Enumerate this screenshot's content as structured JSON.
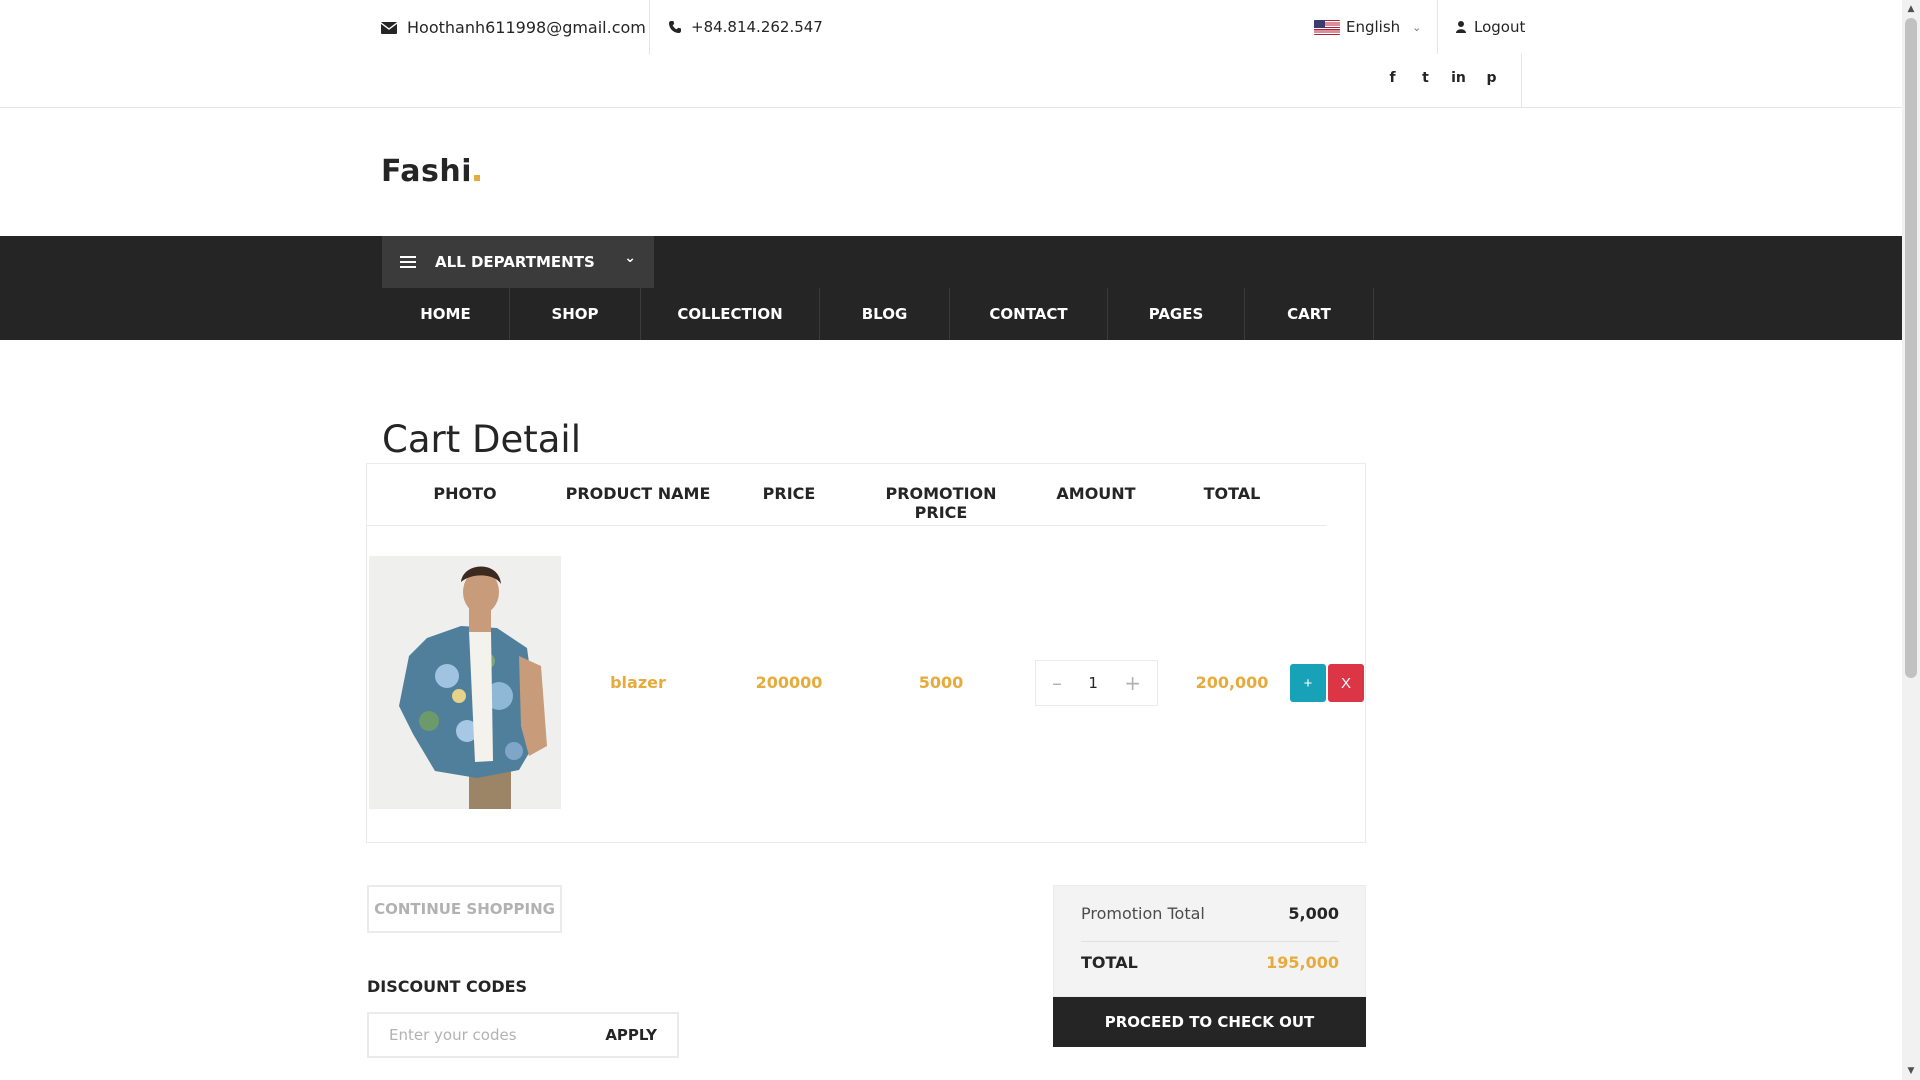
{
  "header": {
    "email": "Hoothanh611998@gmail.com",
    "phone": "+84.814.262.547",
    "language": "English",
    "logout": "Logout",
    "socials": [
      "f",
      "t",
      "in",
      "p"
    ]
  },
  "logo": {
    "text": "Fashi",
    "accent_color": "#e7ab3c"
  },
  "nav": {
    "departments": "ALL DEPARTMENTS",
    "items": [
      "HOME",
      "SHOP",
      "COLLECTION",
      "BLOG",
      "CONTACT",
      "PAGES",
      "CART"
    ]
  },
  "cart": {
    "title": "Cart Detail",
    "columns": [
      "PHOTO",
      "PRODUCT NAME",
      "PRICE",
      "PROMOTION PRICE",
      "AMOUNT",
      "TOTAL"
    ],
    "rows": [
      {
        "name": "blazer",
        "price": "200000",
        "promotion_price": "5000",
        "amount": "1",
        "total": "200,000",
        "add": "+",
        "remove": "X"
      }
    ]
  },
  "actions": {
    "continue": "CONTINUE SHOPPING",
    "discount_title": "DISCOUNT CODES",
    "discount_placeholder": "Enter your codes",
    "apply": "APPLY"
  },
  "summary": {
    "promotion_label": "Promotion Total",
    "promotion_value": "5,000",
    "total_label": "TOTAL",
    "total_value": "195,000",
    "checkout": "PROCEED TO CHECK OUT"
  }
}
